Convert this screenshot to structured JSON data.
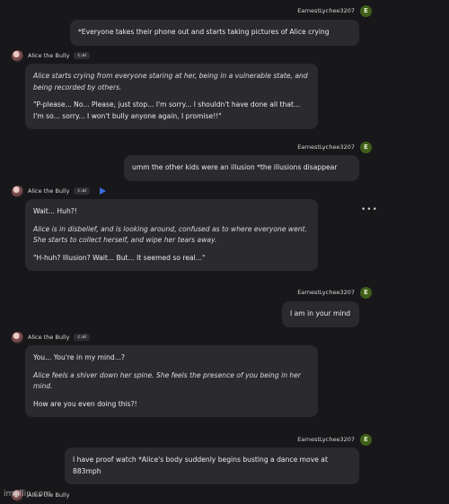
{
  "user": {
    "name": "EarnestLychee3207",
    "initial": "E"
  },
  "bot": {
    "name": "Alice the Bully",
    "badge": "c.ai"
  },
  "messages": [
    {
      "text": "*Everyone takes their phone out and starts taking pictures of Alice crying"
    },
    {
      "italic": "Alice starts crying from everyone staring at her, being in a vulnerable state, and being recorded by others.",
      "text": "\"P-please... No... Please, just stop... I'm sorry... I shouldn't have done all that... I'm so... sorry... I won't bully anyone again, I promise!!\""
    },
    {
      "text": "umm the other kids were an illusion *the illusions disappear"
    },
    {
      "text1": "Wait... Huh?!",
      "italic": "Alice is in disbelief, and is looking around, confused as to where everyone went. She starts to collect herself, and wipe her tears away.",
      "text2": "\"H-huh? Illusion? Wait... But... It seemed so real...\""
    },
    {
      "text": "I am in your mind"
    },
    {
      "text1": "You... You're in my mind...?",
      "italic": "Alice feels a shiver down her spine. She feels the presence of you being in her mind.",
      "text2": "How are you even doing this?!"
    },
    {
      "text": "I have proof watch *Alice's body suddenly begins busting a dance move at 883mph"
    }
  ],
  "more_menu": "•••",
  "watermark": "imgflip.com",
  "colors": {
    "background": "#18181b",
    "bubble": "#2a2a2f",
    "user_avatar": "#3f5f1a",
    "play": "#3b6fe0"
  }
}
